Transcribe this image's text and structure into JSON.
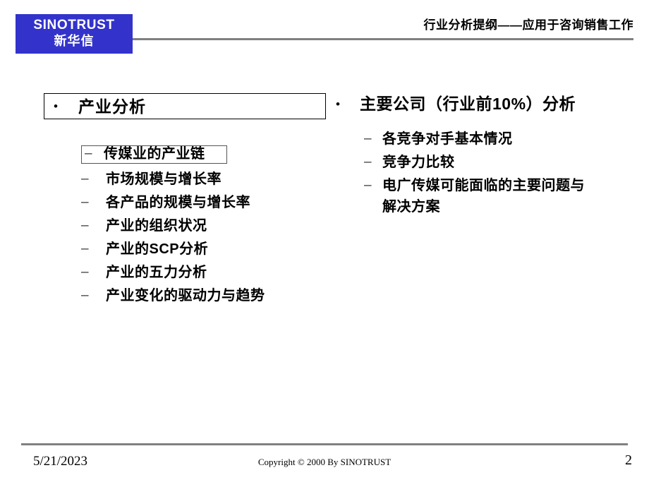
{
  "header": {
    "logo": {
      "latin": "SINOTRUST",
      "chinese": "新华信",
      "background_color": "#3333cc",
      "text_color": "#ffffff"
    },
    "title": "行业分析提纲——应用于咨询销售工作",
    "rule_color": "#808080"
  },
  "body": {
    "left_column": {
      "level1": {
        "bullet": "•",
        "text": "产业分析",
        "boxed": true
      },
      "sub_items": [
        {
          "dash": "–",
          "text": "传媒业的产业链",
          "boxed": true
        },
        {
          "dash": "–",
          "text": "市场规模与增长率",
          "boxed": false
        },
        {
          "dash": "–",
          "text": "各产品的规模与增长率",
          "boxed": false
        },
        {
          "dash": "–",
          "text": "产业的组织状况",
          "boxed": false
        },
        {
          "dash": "–",
          "text": "产业的SCP分析",
          "boxed": false
        },
        {
          "dash": "–",
          "text": "产业的五力分析",
          "boxed": false
        },
        {
          "dash": "–",
          "text": "产业变化的驱动力与趋势",
          "boxed": false
        }
      ]
    },
    "right_column": {
      "level1": {
        "bullet": "•",
        "text": "主要公司（行业前10%）分析"
      },
      "sub_items": [
        {
          "dash": "–",
          "text": "各竞争对手基本情况"
        },
        {
          "dash": "–",
          "text": "竞争力比较"
        },
        {
          "dash": "–",
          "text": "电广传媒可能面临的主要问题与解决方案"
        }
      ]
    }
  },
  "footer": {
    "date": "5/21/2023",
    "copyright": "Copyright © 2000 By SINOTRUST",
    "page_number": "2",
    "rule_color": "#808080"
  }
}
